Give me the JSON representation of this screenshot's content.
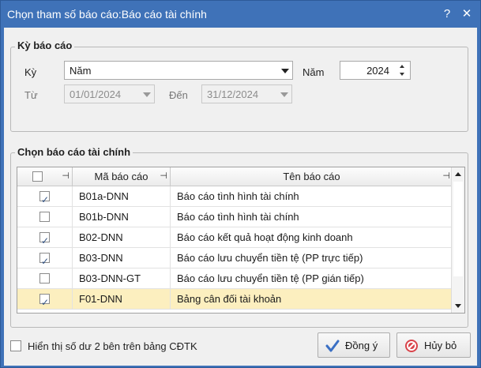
{
  "window": {
    "title": "Chọn tham số báo cáo:Báo cáo tài chính",
    "help_glyph": "?",
    "close_glyph": "✕"
  },
  "period_group": {
    "legend": "Kỳ báo cáo",
    "period_label": "Kỳ",
    "period_value": "Năm",
    "year_label": "Năm",
    "year_value": "2024",
    "from_label": "Từ",
    "from_value": "01/01/2024",
    "to_label": "Đến",
    "to_value": "31/12/2024"
  },
  "report_group": {
    "legend": "Chọn báo cáo tài chính",
    "columns": {
      "code": "Mã báo cáo",
      "name": "Tên báo cáo"
    },
    "pin_glyph": "⊣",
    "rows": [
      {
        "code": "B01a-DNN",
        "name": "Báo cáo tình hình tài chính",
        "checked": true,
        "selected": false
      },
      {
        "code": "B01b-DNN",
        "name": "Báo cáo tình hình tài chính",
        "checked": false,
        "selected": false
      },
      {
        "code": "B02-DNN",
        "name": "Báo cáo kết quả hoạt động kinh doanh",
        "checked": true,
        "selected": false
      },
      {
        "code": "B03-DNN",
        "name": "Báo cáo lưu chuyển tiền tệ (PP trực tiếp)",
        "checked": true,
        "selected": false
      },
      {
        "code": "B03-DNN-GT",
        "name": "Báo cáo lưu chuyển tiền tệ (PP gián tiếp)",
        "checked": false,
        "selected": false
      },
      {
        "code": "F01-DNN",
        "name": "Bảng cân đối tài khoản",
        "checked": true,
        "selected": true
      }
    ]
  },
  "footer": {
    "show_balance_label": "Hiển thị số dư 2 bên trên bảng CĐTK",
    "ok_label": "Đồng ý",
    "cancel_label": "Hủy bỏ"
  },
  "colors": {
    "title_bar": "#3f72b8",
    "selected_row": "#fcefbf",
    "ok_icon": "#3a6fc4",
    "cancel_icon": "#d9434a"
  }
}
